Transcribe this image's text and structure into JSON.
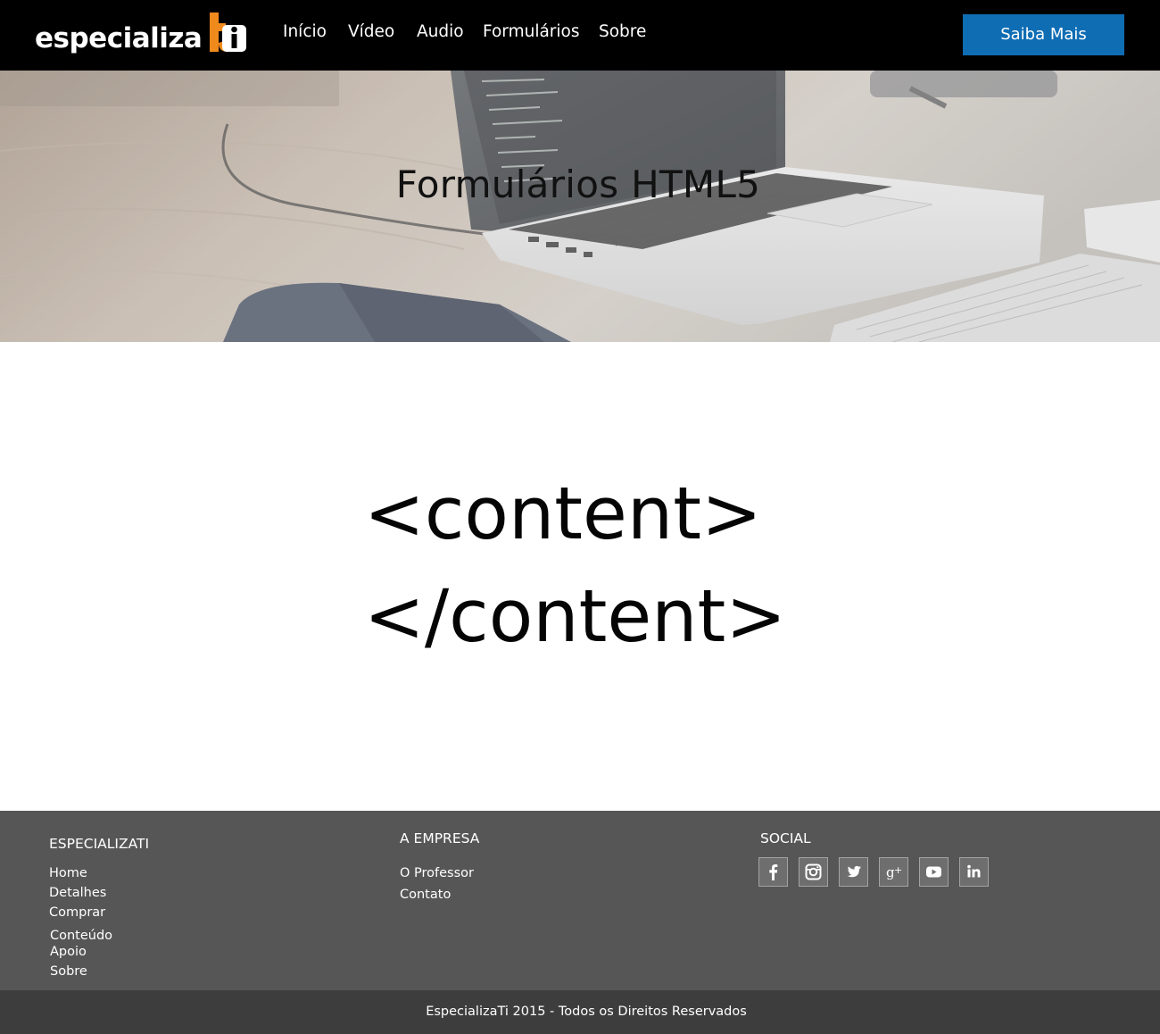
{
  "brand": {
    "logo_text": "especializa",
    "logo_mark": "ti",
    "accent_color": "#f08a1c"
  },
  "nav": {
    "items": [
      {
        "label": "Início"
      },
      {
        "label": "Vídeo"
      },
      {
        "label": "Audio"
      },
      {
        "label": "Formulários"
      },
      {
        "label": "Sobre"
      }
    ],
    "cta_label": "Saiba Mais",
    "cta_color": "#0f6db4"
  },
  "hero": {
    "title": "Formulários HTML5",
    "background": "laptop-desk-photo"
  },
  "content": {
    "open_tag": "<content>",
    "close_tag": "</content>"
  },
  "footer": {
    "col1": {
      "heading": "ESPECIALIZATI",
      "links": [
        "Home",
        "Detalhes",
        "Comprar",
        "Conteúdo",
        "Apoio",
        "Sobre"
      ]
    },
    "col2": {
      "heading": "A EMPRESA",
      "links": [
        "O Professor",
        "Contato"
      ]
    },
    "col3": {
      "heading": "SOCIAL",
      "icons": [
        "facebook-icon",
        "instagram-icon",
        "twitter-icon",
        "google-plus-icon",
        "youtube-icon",
        "linkedin-icon"
      ]
    },
    "copyright": "EspecializaTi 2015 - Todos os Direitos Reservados"
  }
}
